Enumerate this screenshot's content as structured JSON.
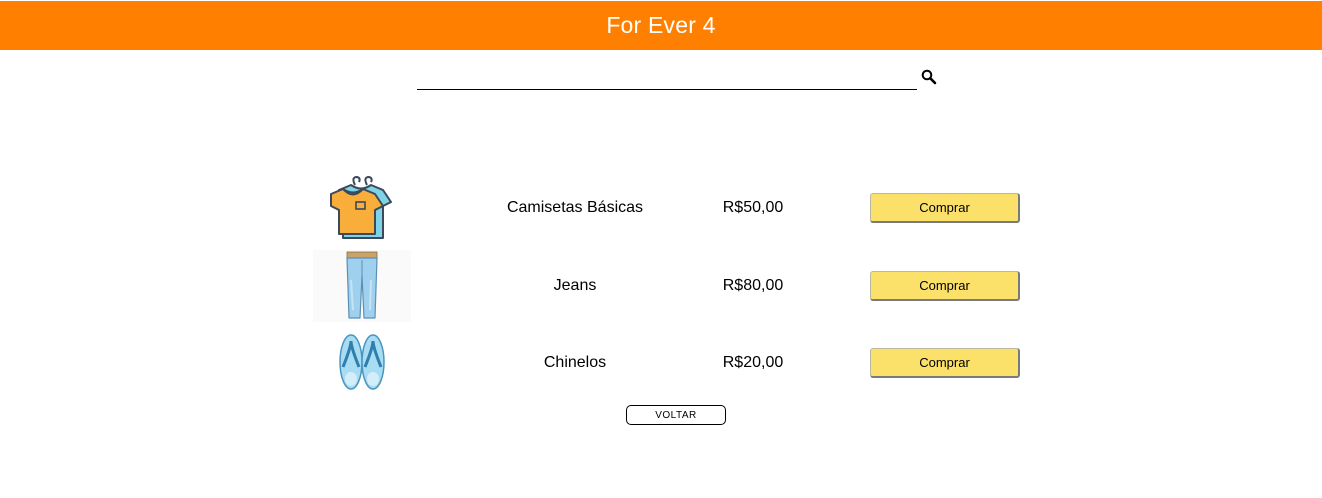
{
  "header": {
    "title": "For Ever 4",
    "background_color": "#ff8000"
  },
  "search": {
    "value": "",
    "placeholder": "",
    "icon": "search-icon"
  },
  "products": [
    {
      "image": "t-shirt-icon",
      "name": "Camisetas Básicas",
      "price": "R$50,00",
      "button_label": "Comprar"
    },
    {
      "image": "jeans-icon",
      "name": "Jeans",
      "price": "R$80,00",
      "button_label": "Comprar"
    },
    {
      "image": "flip-flops-icon",
      "name": "Chinelos",
      "price": "R$20,00",
      "button_label": "Comprar"
    }
  ],
  "back_button": {
    "label": "VOLTAR"
  },
  "colors": {
    "buy_button": "#fbe069",
    "shirt": "#f9ae3b",
    "shirt_back": "#7fd3e6",
    "jeans": "#9fd0ee",
    "flip_flop": "#a8dcf2"
  }
}
